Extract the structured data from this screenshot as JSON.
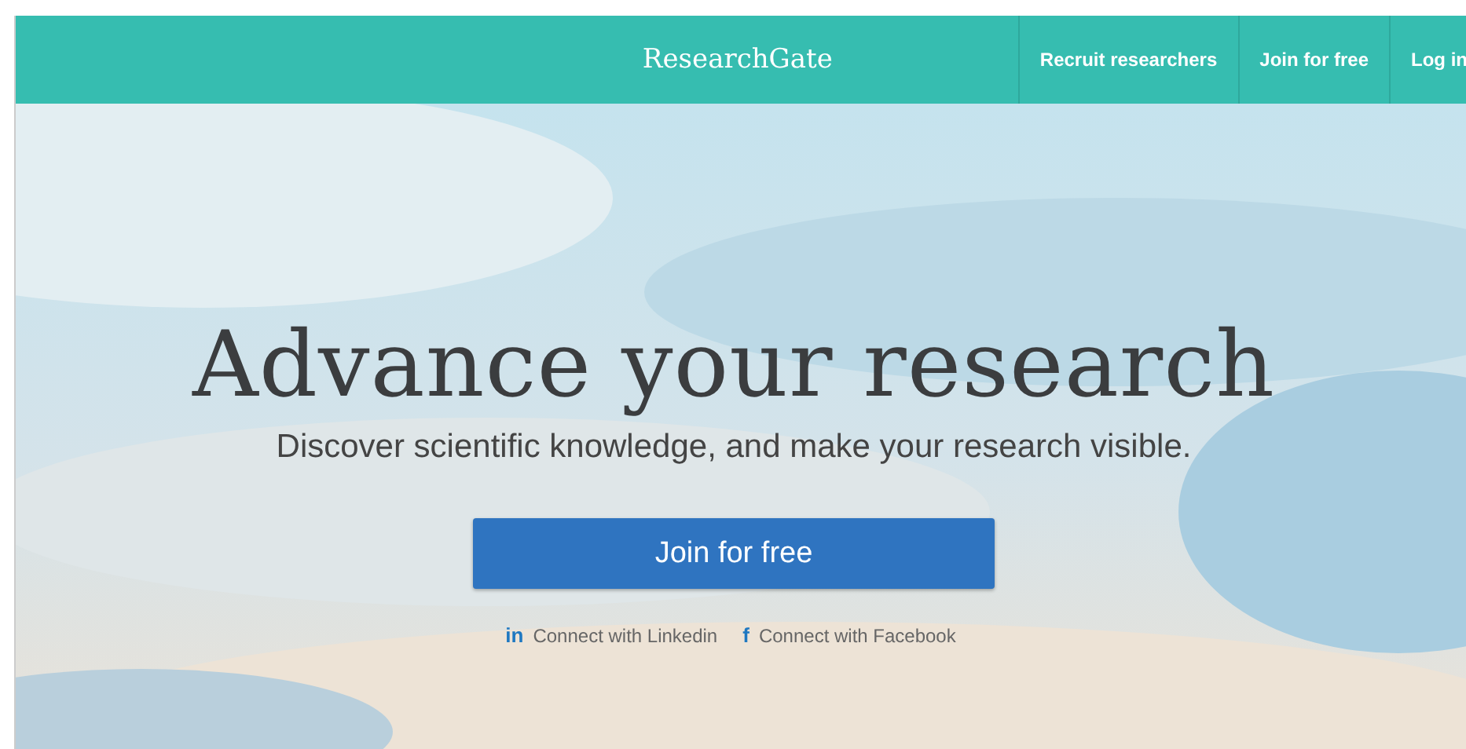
{
  "header": {
    "logo": "ResearchGate",
    "nav": [
      {
        "label": "Recruit researchers"
      },
      {
        "label": "Join for free"
      },
      {
        "label": "Log in"
      }
    ]
  },
  "hero": {
    "title": "Advance your research",
    "subtitle": "Discover scientific knowledge, and make your research visible.",
    "button": "Join for free",
    "connect": [
      {
        "icon": "in",
        "label": "Connect with Linkedin"
      },
      {
        "icon": "f",
        "label": "Connect with Facebook"
      }
    ]
  }
}
